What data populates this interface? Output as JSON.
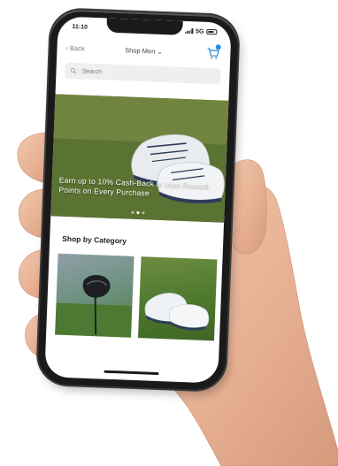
{
  "status_bar": {
    "time": "11:10",
    "network": "5G"
  },
  "nav": {
    "back_label": "Back",
    "title": "Shop Men",
    "cart_icon": "cart-icon"
  },
  "search": {
    "placeholder": "Search"
  },
  "hero": {
    "text": "Earn up to 10% Cash-Back in Vivo Reward Points on Every Purchase",
    "slides": 3,
    "active_slide": 1
  },
  "category_section": {
    "title": "Shop by Category",
    "tiles": [
      {
        "name": "driver"
      },
      {
        "name": "shoes"
      }
    ]
  },
  "colors": {
    "accent": "#2a8bd8",
    "grass": "#4f6a29",
    "phone_body": "#1a1a1a",
    "search_bg": "#f1eeee"
  }
}
